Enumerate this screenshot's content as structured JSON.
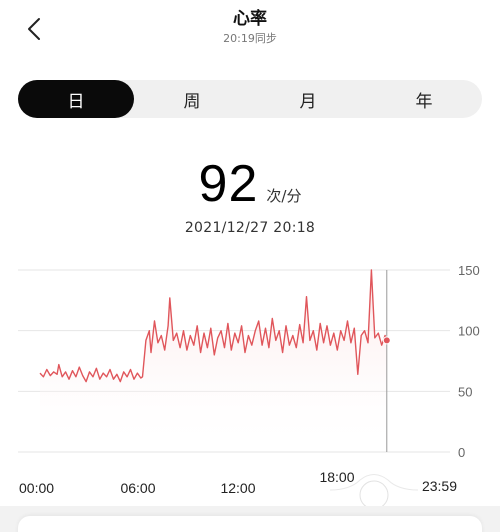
{
  "header": {
    "back_icon": "chevron-left-icon",
    "title": "心率",
    "sync_status": "20:19同步"
  },
  "tabs": [
    {
      "label": "日",
      "active": true
    },
    {
      "label": "周",
      "active": false
    },
    {
      "label": "月",
      "active": false
    },
    {
      "label": "年",
      "active": false
    }
  ],
  "reading": {
    "value": "92",
    "unit": "次/分",
    "datetime": "2021/12/27 20:18"
  },
  "colors": {
    "line": "#e0565b",
    "fill_top": "#fbe3e4",
    "accent_tab": "#0a0a0a",
    "grid": "#e6e6e6",
    "cursor": "#999999"
  },
  "chart_data": {
    "type": "line",
    "title": "",
    "xlabel": "",
    "ylabel": "",
    "x_tick_labels": [
      "00:00",
      "06:00",
      "12:00",
      "18:00",
      "23:59"
    ],
    "y_tick_labels": [
      "150",
      "100",
      "50",
      "0"
    ],
    "ylim": [
      0,
      150
    ],
    "xlim_hours": [
      0,
      24
    ],
    "grid": true,
    "y_axis_position": "right",
    "selected": {
      "time": "20:18",
      "value": 92
    },
    "series": [
      {
        "values": [
          [
            0.0,
            65
          ],
          [
            0.2,
            62
          ],
          [
            0.4,
            68
          ],
          [
            0.6,
            63
          ],
          [
            0.8,
            66
          ],
          [
            1.0,
            64
          ],
          [
            1.1,
            72
          ],
          [
            1.3,
            62
          ],
          [
            1.5,
            66
          ],
          [
            1.7,
            60
          ],
          [
            1.9,
            67
          ],
          [
            2.1,
            62
          ],
          [
            2.3,
            70
          ],
          [
            2.5,
            63
          ],
          [
            2.7,
            58
          ],
          [
            2.9,
            66
          ],
          [
            3.1,
            62
          ],
          [
            3.3,
            69
          ],
          [
            3.5,
            60
          ],
          [
            3.7,
            65
          ],
          [
            3.9,
            62
          ],
          [
            4.1,
            68
          ],
          [
            4.3,
            60
          ],
          [
            4.5,
            64
          ],
          [
            4.7,
            58
          ],
          [
            4.9,
            66
          ],
          [
            5.1,
            62
          ],
          [
            5.3,
            68
          ],
          [
            5.5,
            60
          ],
          [
            5.7,
            65
          ],
          [
            5.9,
            61
          ],
          [
            6.0,
            62
          ],
          [
            6.2,
            92
          ],
          [
            6.4,
            100
          ],
          [
            6.5,
            82
          ],
          [
            6.7,
            108
          ],
          [
            6.9,
            90
          ],
          [
            7.1,
            96
          ],
          [
            7.3,
            84
          ],
          [
            7.5,
            104
          ],
          [
            7.6,
            127
          ],
          [
            7.8,
            92
          ],
          [
            8.0,
            98
          ],
          [
            8.2,
            86
          ],
          [
            8.4,
            100
          ],
          [
            8.6,
            84
          ],
          [
            8.8,
            96
          ],
          [
            9.0,
            88
          ],
          [
            9.2,
            104
          ],
          [
            9.4,
            82
          ],
          [
            9.6,
            98
          ],
          [
            9.8,
            86
          ],
          [
            10.0,
            102
          ],
          [
            10.2,
            80
          ],
          [
            10.4,
            94
          ],
          [
            10.6,
            100
          ],
          [
            10.8,
            86
          ],
          [
            11.0,
            106
          ],
          [
            11.2,
            84
          ],
          [
            11.4,
            98
          ],
          [
            11.6,
            90
          ],
          [
            11.8,
            104
          ],
          [
            12.0,
            82
          ],
          [
            12.2,
            96
          ],
          [
            12.4,
            88
          ],
          [
            12.6,
            100
          ],
          [
            12.8,
            108
          ],
          [
            13.0,
            88
          ],
          [
            13.2,
            102
          ],
          [
            13.4,
            86
          ],
          [
            13.6,
            110
          ],
          [
            13.8,
            92
          ],
          [
            14.0,
            100
          ],
          [
            14.2,
            82
          ],
          [
            14.4,
            104
          ],
          [
            14.6,
            88
          ],
          [
            14.8,
            96
          ],
          [
            15.0,
            86
          ],
          [
            15.2,
            105
          ],
          [
            15.4,
            90
          ],
          [
            15.6,
            128
          ],
          [
            15.8,
            92
          ],
          [
            16.0,
            100
          ],
          [
            16.2,
            84
          ],
          [
            16.4,
            106
          ],
          [
            16.6,
            90
          ],
          [
            16.8,
            104
          ],
          [
            17.0,
            88
          ],
          [
            17.2,
            98
          ],
          [
            17.4,
            84
          ],
          [
            17.6,
            100
          ],
          [
            17.8,
            92
          ],
          [
            18.0,
            108
          ],
          [
            18.2,
            90
          ],
          [
            18.4,
            102
          ],
          [
            18.6,
            64
          ],
          [
            18.8,
            96
          ],
          [
            19.0,
            100
          ],
          [
            19.2,
            90
          ],
          [
            19.4,
            150
          ],
          [
            19.6,
            94
          ],
          [
            19.8,
            98
          ],
          [
            20.0,
            88
          ],
          [
            20.2,
            96
          ],
          [
            20.3,
            92
          ]
        ]
      }
    ]
  }
}
